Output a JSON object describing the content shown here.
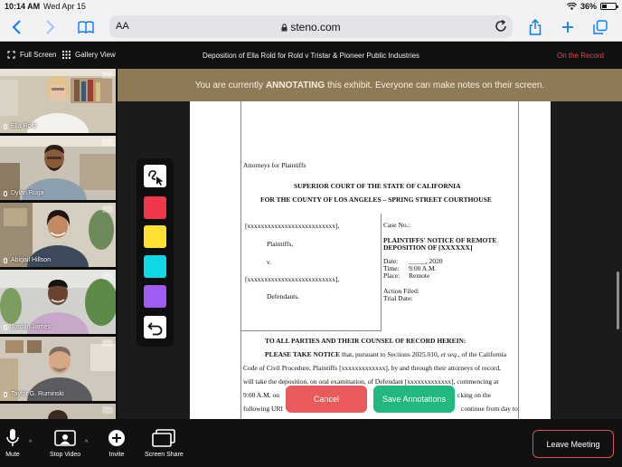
{
  "status_bar": {
    "time": "10:14 AM",
    "date": "Wed Apr 15",
    "battery": "36%"
  },
  "browser": {
    "text_size_label": "AA",
    "url": "steno.com"
  },
  "meeting_bar": {
    "full_screen": "Full Screen",
    "gallery_view": "Gallery View",
    "title": "Deposition of Ella Rold for Rold v Tristar & Pioneer Public Industries",
    "record_status": "On the Record"
  },
  "banner": {
    "prefix": "You are currently",
    "mode": "ANNOTATING",
    "suffix": "this exhibit. Everyone can make notes on their screen."
  },
  "participants": [
    {
      "name": "Ella Rold"
    },
    {
      "name": "Dylan Ruga"
    },
    {
      "name": "Abigail Hillson"
    },
    {
      "name": "Jordan James"
    },
    {
      "name": "Taylor G. Ruminski"
    }
  ],
  "annotation_tools": {
    "colors": [
      "#f0384a",
      "#ffe033",
      "#10d7e6",
      "#a05cf0"
    ],
    "pen_icon": "pen-cursor-icon",
    "undo_icon": "undo-icon"
  },
  "document": {
    "attorneys": "Attorneys for Plaintiffs",
    "court_line1": "SUPERIOR COURT OF THE STATE OF CALIFORNIA",
    "court_line2": "FOR THE COUNTY OF LOS ANGELES – SPRING STREET COURTHOUSE",
    "party1": "[xxxxxxxxxxxxxxxxxxxxxxxxxx],",
    "plaintiffs": "Plaintiffs,",
    "v": "v.",
    "party2": "[xxxxxxxxxxxxxxxxxxxxxxxxxx],",
    "defendants": "Defendants.",
    "case_no": "Case No.:",
    "notice_line1": "PLAINTIFFS' NOTICE OF REMOTE",
    "notice_line2": "DEPOSITION OF [XXXXXX]",
    "date_label": "Date:",
    "date_value": "_____, 2020",
    "time_label": "Time:",
    "time_value": "9:00 A.M.",
    "place_label": "Place:",
    "place_value": "Remote",
    "action_filed": "Action Filed:",
    "trial_date": "Trial Date:",
    "to_all": "TO ALL PARTIES AND THEIR COUNSEL OF RECORD HEREIN:",
    "body1a": "PLEASE TAKE NOTICE",
    "body1b": " that, pursuant to Sections 2025.010, ",
    "body1c": "et seq.",
    "body1d": ", of the California",
    "body2": "Code of Civil Procedure, Plaintiffs [xxxxxxxxxxxxx], by and through their attorneys of record,",
    "body3": "will take the deposition, on oral examination, of Defendant [xxxxxxxxxxxxx], commencing at",
    "body4a": "9:00 A.M. on",
    "body4b": "cking on the",
    "body5a": "following URI",
    "body5b": "continue from day to"
  },
  "buttons": {
    "cancel": "Cancel",
    "save": "Save Annotations"
  },
  "controls": {
    "mute": "Mute",
    "stop_video": "Stop Video",
    "invite": "Invite",
    "screen_share": "Screen Share",
    "leave": "Leave Meeting"
  }
}
